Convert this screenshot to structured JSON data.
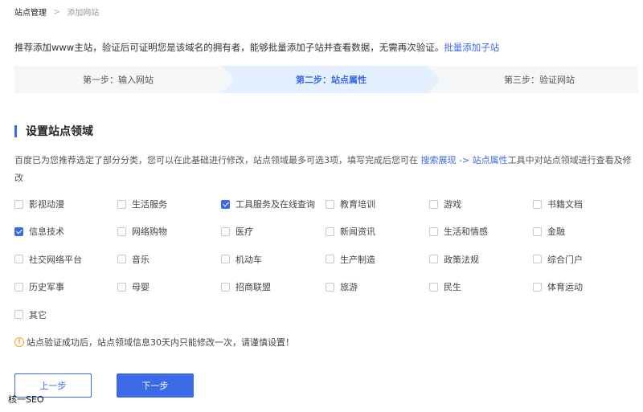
{
  "breadcrumb": {
    "current": "站点管理",
    "separator": ">",
    "last": "添加网站"
  },
  "intro": {
    "text": "推荐添加www主站，验证后可证明您是该域名的拥有者，能够批量添加子站并查看数据，无需再次验证。",
    "link": "批量添加子站"
  },
  "steps": [
    {
      "label": "第一步：输入网站"
    },
    {
      "label": "第二步：站点属性",
      "active": true
    },
    {
      "label": "第三步：验证网站"
    }
  ],
  "section": {
    "title": "设置站点领域"
  },
  "desc": {
    "part1": "百度已为您推荐选定了部分分类，您可以在此基础进行修改，站点领域最多可选3项，填写完成后您可在 ",
    "link1": "搜索展现 -> 站点属性",
    "part2": "工具中对站点领域进行查看及修改"
  },
  "options": [
    {
      "label": "影视动漫",
      "checked": false
    },
    {
      "label": "生活服务",
      "checked": false
    },
    {
      "label": "工具服务及在线查询",
      "checked": true
    },
    {
      "label": "教育培训",
      "checked": false
    },
    {
      "label": "游戏",
      "checked": false
    },
    {
      "label": "书籍文档",
      "checked": false
    },
    {
      "label": "信息技术",
      "checked": true
    },
    {
      "label": "网络购物",
      "checked": false
    },
    {
      "label": "医疗",
      "checked": false
    },
    {
      "label": "新闻资讯",
      "checked": false
    },
    {
      "label": "生活和情感",
      "checked": false
    },
    {
      "label": "金融",
      "checked": false
    },
    {
      "label": "社交网络平台",
      "checked": false
    },
    {
      "label": "音乐",
      "checked": false
    },
    {
      "label": "机动车",
      "checked": false
    },
    {
      "label": "生产制造",
      "checked": false
    },
    {
      "label": "政策法规",
      "checked": false
    },
    {
      "label": "综合门户",
      "checked": false
    },
    {
      "label": "历史军事",
      "checked": false
    },
    {
      "label": "母婴",
      "checked": false
    },
    {
      "label": "招商联盟",
      "checked": false
    },
    {
      "label": "旅游",
      "checked": false
    },
    {
      "label": "民生",
      "checked": false
    },
    {
      "label": "体育运动",
      "checked": false
    },
    {
      "label": "其它",
      "checked": false
    }
  ],
  "warning": {
    "icon": "warning-icon",
    "text": "站点验证成功后，站点领域信息30天内只能修改一次，请谨慎设置！"
  },
  "buttons": {
    "prev": "上一步",
    "next": "下一步"
  },
  "watermark": "核一SEO",
  "colors": {
    "accent": "#3b6ae8",
    "active_step_bg": "#e4efff",
    "step_bg": "#f5f6f8",
    "warning": "#f2a53a"
  }
}
